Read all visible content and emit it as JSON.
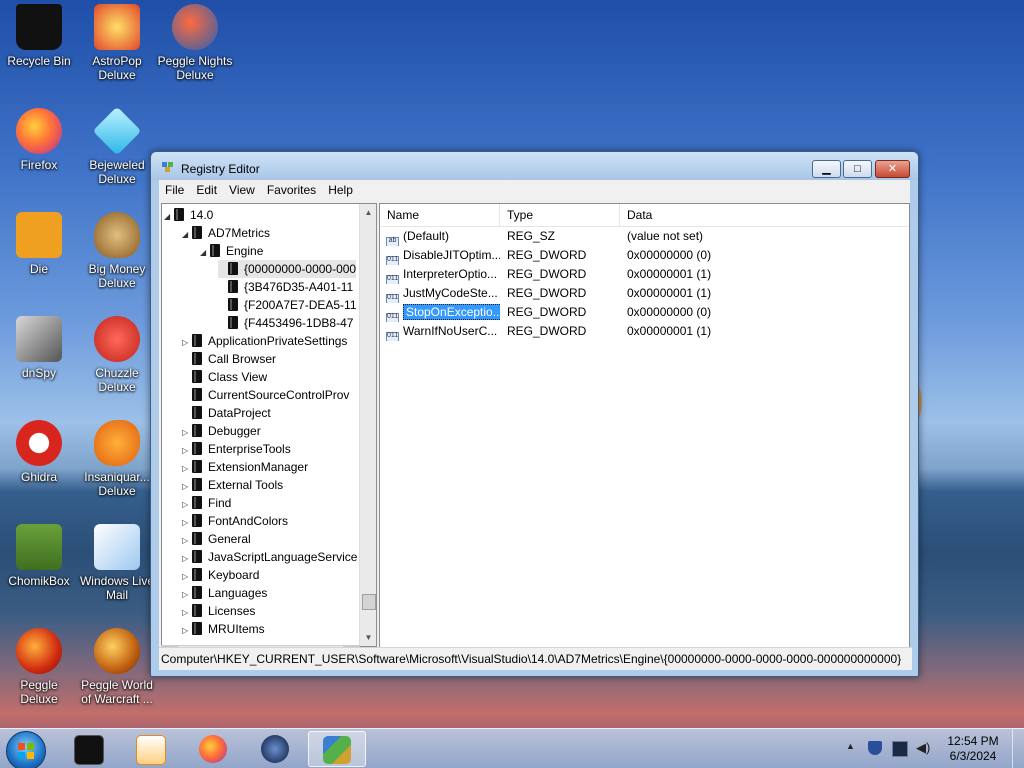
{
  "desktop": {
    "icons": [
      {
        "label": "Recycle Bin",
        "icon": "recycle-bin-icon"
      },
      {
        "label": "AstroPop Deluxe",
        "icon": "astropop-icon"
      },
      {
        "label": "Peggle Nights Deluxe",
        "icon": "peggle-nights-icon"
      },
      {
        "label": "Firefox",
        "icon": "firefox-icon"
      },
      {
        "label": "Bejeweled Deluxe",
        "icon": "bejeweled-icon"
      },
      {
        "label": "Die",
        "icon": "die-icon"
      },
      {
        "label": "Big Money Deluxe",
        "icon": "big-money-icon"
      },
      {
        "label": "dnSpy",
        "icon": "dnspy-icon"
      },
      {
        "label": "Chuzzle Deluxe",
        "icon": "chuzzle-icon"
      },
      {
        "label": "Ghidra",
        "icon": "ghidra-icon"
      },
      {
        "label": "Insaniquar... Deluxe",
        "icon": "insaniquarium-icon"
      },
      {
        "label": "ChomikBox",
        "icon": "chomikbox-icon"
      },
      {
        "label": "Windows Live Mail",
        "icon": "windows-live-mail-icon"
      },
      {
        "label": "Peggle Deluxe",
        "icon": "peggle-deluxe-icon"
      },
      {
        "label": "Peggle World of Warcraft ...",
        "icon": "peggle-wow-icon"
      }
    ]
  },
  "window": {
    "title": "Registry Editor",
    "menu": [
      "File",
      "Edit",
      "View",
      "Favorites",
      "Help"
    ],
    "controls": {
      "minimize": "▁",
      "maximize": "□",
      "close": "✕"
    },
    "tree": [
      {
        "label": "14.0",
        "level": 0,
        "twisty": "◢"
      },
      {
        "label": "AD7Metrics",
        "level": 1,
        "twisty": "◢"
      },
      {
        "label": "Engine",
        "level": 2,
        "twisty": "◢"
      },
      {
        "label": "{00000000-0000-000",
        "level": 3,
        "twisty": "",
        "selected": true
      },
      {
        "label": "{3B476D35-A401-11",
        "level": 3,
        "twisty": ""
      },
      {
        "label": "{F200A7E7-DEA5-11",
        "level": 3,
        "twisty": ""
      },
      {
        "label": "{F4453496-1DB8-47",
        "level": 3,
        "twisty": ""
      },
      {
        "label": "ApplicationPrivateSettings",
        "level": 1,
        "twisty": "▷"
      },
      {
        "label": "Call Browser",
        "level": 1,
        "twisty": ""
      },
      {
        "label": "Class View",
        "level": 1,
        "twisty": ""
      },
      {
        "label": "CurrentSourceControlProv",
        "level": 1,
        "twisty": ""
      },
      {
        "label": "DataProject",
        "level": 1,
        "twisty": ""
      },
      {
        "label": "Debugger",
        "level": 1,
        "twisty": "▷"
      },
      {
        "label": "EnterpriseTools",
        "level": 1,
        "twisty": "▷"
      },
      {
        "label": "ExtensionManager",
        "level": 1,
        "twisty": "▷"
      },
      {
        "label": "External Tools",
        "level": 1,
        "twisty": "▷"
      },
      {
        "label": "Find",
        "level": 1,
        "twisty": "▷"
      },
      {
        "label": "FontAndColors",
        "level": 1,
        "twisty": "▷"
      },
      {
        "label": "General",
        "level": 1,
        "twisty": "▷"
      },
      {
        "label": "JavaScriptLanguageService",
        "level": 1,
        "twisty": "▷"
      },
      {
        "label": "Keyboard",
        "level": 1,
        "twisty": "▷"
      },
      {
        "label": "Languages",
        "level": 1,
        "twisty": "▷"
      },
      {
        "label": "Licenses",
        "level": 1,
        "twisty": "▷"
      },
      {
        "label": "MRUItems",
        "level": 1,
        "twisty": "▷"
      }
    ],
    "list": {
      "columns": [
        "Name",
        "Type",
        "Data"
      ],
      "rows": [
        {
          "name": "(Default)",
          "type": "REG_SZ",
          "data": "(value not set)",
          "icon": "string-value-icon"
        },
        {
          "name": "DisableJITOptim...",
          "type": "REG_DWORD",
          "data": "0x00000000 (0)",
          "icon": "dword-value-icon"
        },
        {
          "name": "InterpreterOptio...",
          "type": "REG_DWORD",
          "data": "0x00000001 (1)",
          "icon": "dword-value-icon"
        },
        {
          "name": "JustMyCodeSte...",
          "type": "REG_DWORD",
          "data": "0x00000001 (1)",
          "icon": "dword-value-icon"
        },
        {
          "name": "StopOnExceptio...",
          "type": "REG_DWORD",
          "data": "0x00000000 (0)",
          "icon": "dword-value-icon",
          "selected": true
        },
        {
          "name": "WarnIfNoUserC...",
          "type": "REG_DWORD",
          "data": "0x00000001 (1)",
          "icon": "dword-value-icon"
        }
      ]
    },
    "status": "Computer\\HKEY_CURRENT_USER\\Software\\Microsoft\\VisualStudio\\14.0\\AD7Metrics\\Engine\\{00000000-0000-0000-0000-000000000000}"
  },
  "taskbar": {
    "items": [
      "terminal-app-icon",
      "media-player-icon",
      "firefox-icon",
      "ghidra-app-icon",
      "registry-editor-icon"
    ],
    "active_index": 4,
    "clock": {
      "time": "12:54 PM",
      "date": "6/3/2024"
    }
  }
}
